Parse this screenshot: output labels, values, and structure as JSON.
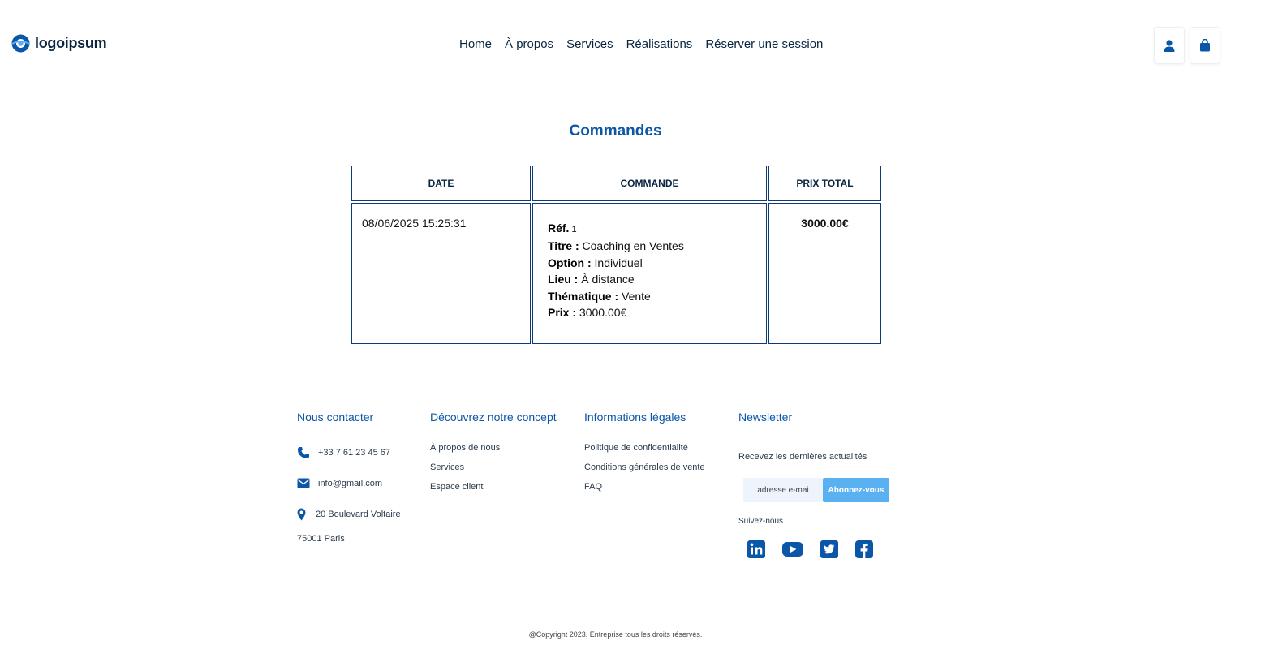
{
  "header": {
    "logo_text": "logoipsum",
    "nav": [
      "Home",
      "À propos",
      "Services",
      "Réalisations",
      "Réserver une session"
    ],
    "icons": [
      "user-icon",
      "shopping-bag-icon"
    ]
  },
  "main": {
    "title": "Commandes",
    "table": {
      "headers": [
        "DATE",
        "COMMANDE",
        "PRIX TOTAL"
      ],
      "rows": [
        {
          "date": "08/06/2025 15:25:31",
          "details": [
            {
              "label": "Réf.",
              "value": " 1"
            },
            {
              "label": "Titre :",
              "value": " Coaching en Ventes"
            },
            {
              "label": "Option :",
              "value": " Individuel"
            },
            {
              "label": "Lieu :",
              "value": " À distance"
            },
            {
              "label": "Thématique :",
              "value": " Vente"
            },
            {
              "label": "Prix :",
              "value": " 3000.00€"
            }
          ],
          "total": "3000.00€"
        }
      ]
    }
  },
  "footer": {
    "contact": {
      "title": "Nous contacter",
      "phone": "+33 7 61 23 45 67",
      "email": "info@gmail.com",
      "address_line1": "20 Boulevard Voltaire",
      "address_line2": "75001 Paris"
    },
    "concept": {
      "title": "Découvrez notre concept",
      "links": [
        "À propos de nous",
        "Services",
        "Espace client"
      ]
    },
    "legal": {
      "title": "Informations légales",
      "links": [
        "Politique de confidentialité",
        "Conditions générales de vente",
        "FAQ"
      ]
    },
    "newsletter": {
      "title": "Newsletter",
      "subtitle": "Recevez les dernières actualités",
      "input_placeholder": "adresse e-mai",
      "button_label": "Abonnez-vous",
      "follow_label": "Suivez-nous",
      "social_icons": [
        "linkedin-icon",
        "youtube-icon",
        "twitter-icon",
        "facebook-icon"
      ]
    },
    "copyright": "@Copyright 2023. Entreprise tous les droits réservés."
  },
  "colors": {
    "brand_blue": "#0b56a6",
    "dark_navy": "#0a2540",
    "button_blue": "#5ab1f2",
    "table_border": "#0b3b78"
  }
}
